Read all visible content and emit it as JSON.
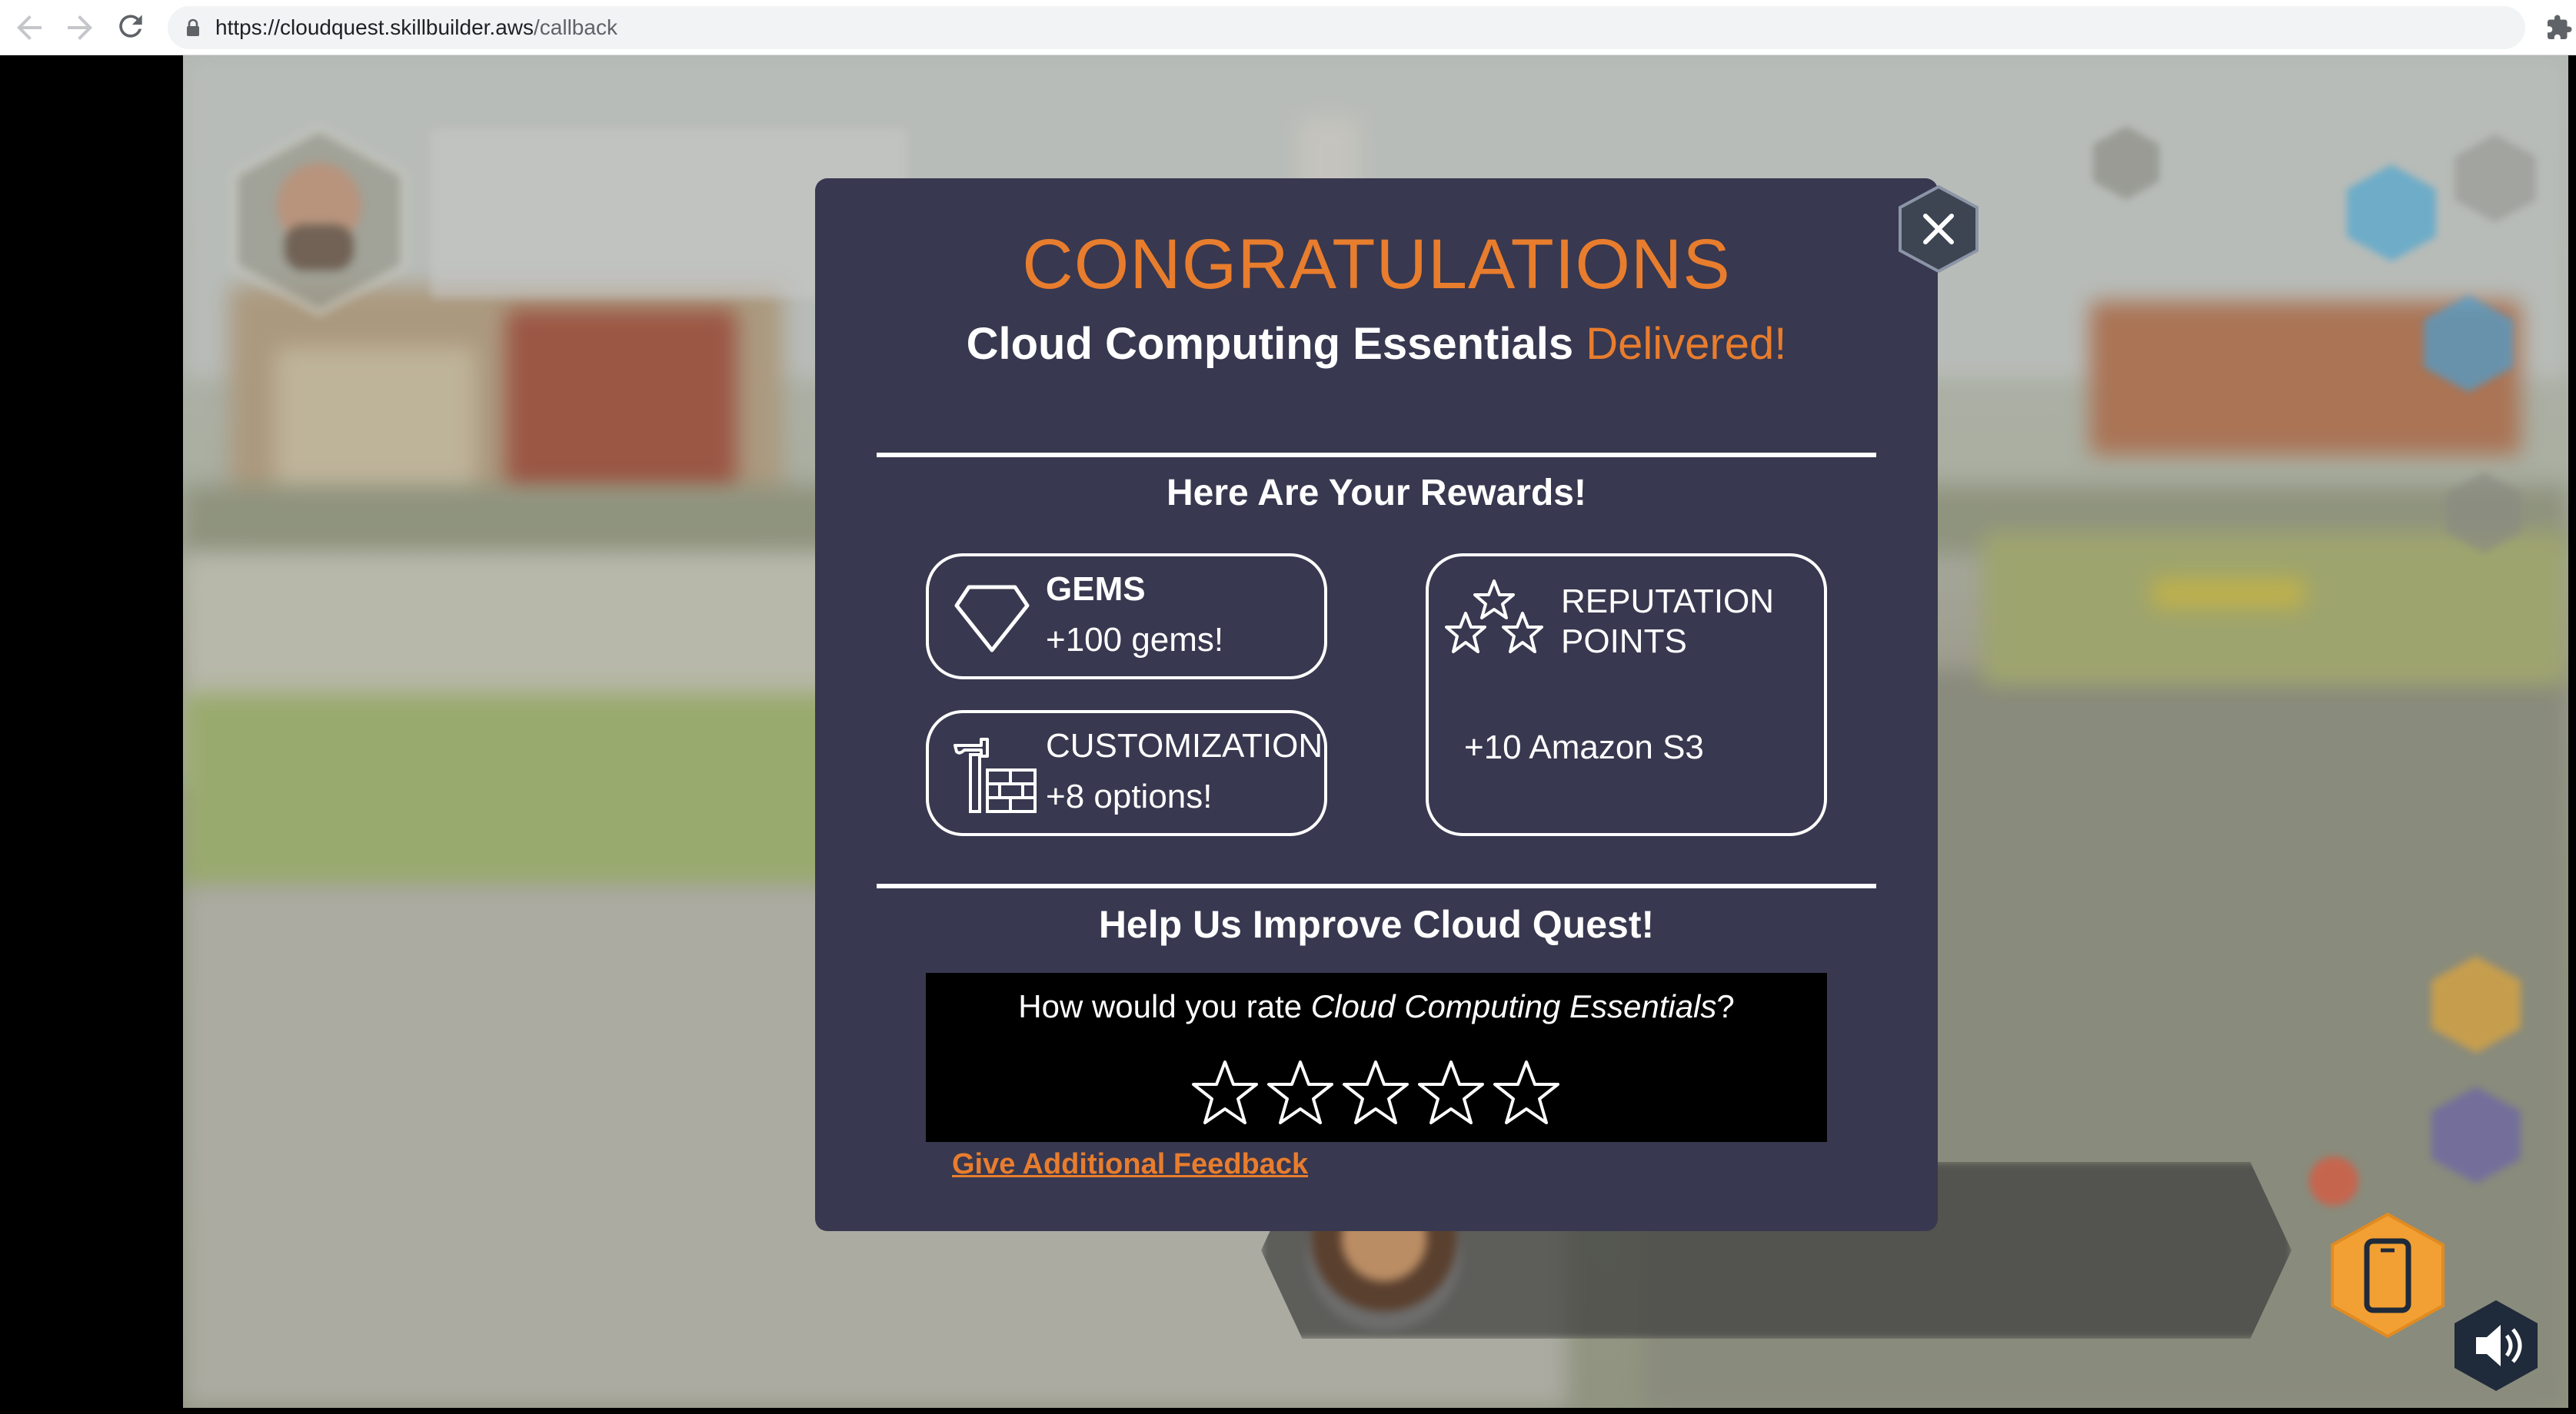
{
  "browser": {
    "url_host": "https://cloudquest.skillbuilder.aws",
    "url_path": "/callback",
    "back_icon": "arrow-left-icon",
    "forward_icon": "arrow-right-icon",
    "reload_icon": "reload-icon"
  },
  "modal": {
    "title": "CONGRATULATIONS",
    "subtitle_main": "Cloud Computing Essentials",
    "subtitle_accent": "Delivered!",
    "rewards_heading": "Here Are Your Rewards!",
    "rewards": {
      "gems": {
        "label": "GEMS",
        "value": "+100 gems!",
        "icon": "diamond-icon"
      },
      "customization": {
        "label": "CUSTOMIZATION",
        "value": "+8 options!",
        "icon": "hammer-brick-icon"
      },
      "reputation": {
        "label_line1": "REPUTATION",
        "label_line2": "POINTS",
        "value": "+10 Amazon S3",
        "icon": "stars-icon"
      }
    },
    "help_heading": "Help Us Improve Cloud Quest!",
    "rating": {
      "question_prefix": "How would you rate ",
      "question_course": "Cloud Computing Essentials",
      "question_suffix": "?",
      "max_stars": 5,
      "selected": 0
    },
    "feedback_link": "Give Additional Feedback",
    "close_icon": "close-icon"
  },
  "colors": {
    "accent": "#e87d2d",
    "modal_bg": "#383850",
    "hud_orange": "#f2a033",
    "hud_dark": "#1f2a3a"
  }
}
